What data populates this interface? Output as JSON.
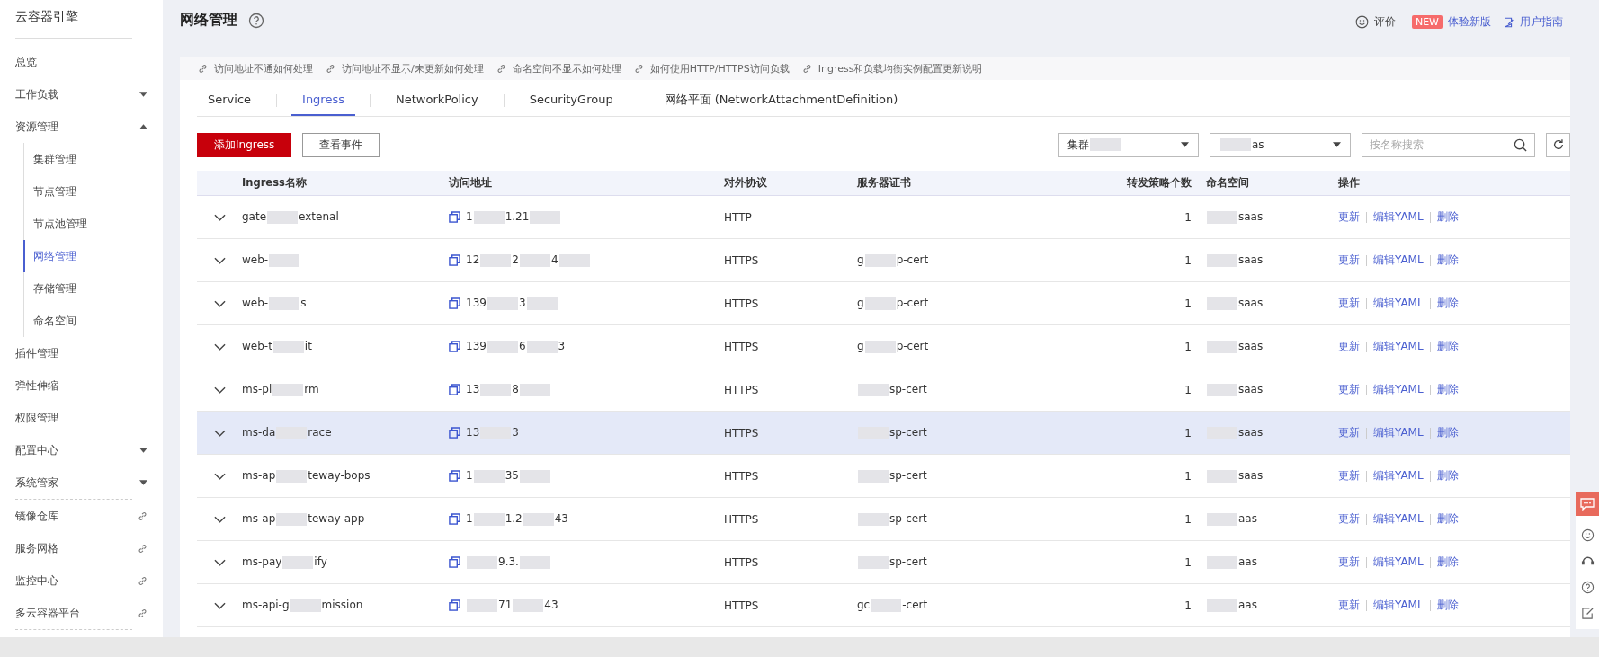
{
  "sidebar": {
    "title": "云容器引擎",
    "items": [
      {
        "label": "总览",
        "kind": "item",
        "selected": false
      },
      {
        "label": "工作负载",
        "kind": "group",
        "expanded": false,
        "selected": false
      },
      {
        "label": "资源管理",
        "kind": "group",
        "expanded": true,
        "selected": false,
        "children": [
          {
            "label": "集群管理",
            "selected": false
          },
          {
            "label": "节点管理",
            "selected": false
          },
          {
            "label": "节点池管理",
            "selected": false
          },
          {
            "label": "网络管理",
            "selected": true
          },
          {
            "label": "存储管理",
            "selected": false
          },
          {
            "label": "命名空间",
            "selected": false
          }
        ]
      },
      {
        "label": "插件管理",
        "kind": "item",
        "selected": false
      },
      {
        "label": "弹性伸缩",
        "kind": "item",
        "selected": false
      },
      {
        "label": "权限管理",
        "kind": "item",
        "selected": false
      },
      {
        "label": "配置中心",
        "kind": "group",
        "expanded": false,
        "selected": false
      },
      {
        "label": "系统管家",
        "kind": "group",
        "expanded": false,
        "selected": false
      },
      {
        "kind": "divider"
      },
      {
        "label": "镜像仓库",
        "kind": "link",
        "selected": false
      },
      {
        "label": "服务网格",
        "kind": "link",
        "selected": false
      },
      {
        "label": "监控中心",
        "kind": "link",
        "selected": false
      },
      {
        "label": "多云容器平台",
        "kind": "link",
        "selected": false
      },
      {
        "kind": "divider"
      }
    ]
  },
  "header": {
    "title": "网络管理",
    "rate": "评价",
    "new_badge": "NEW",
    "new_version": "体验新版",
    "guide": "用户指南"
  },
  "help_links": [
    "访问地址不通如何处理",
    "访问地址不显示/未更新如何处理",
    "命名空间不显示如何处理",
    "如何使用HTTP/HTTPS访问负载",
    "Ingress和负载均衡实例配置更新说明"
  ],
  "tabs": [
    {
      "label": "Service",
      "selected": false
    },
    {
      "label": "Ingress",
      "selected": true
    },
    {
      "label": "NetworkPolicy",
      "selected": false
    },
    {
      "label": "SecurityGroup",
      "selected": false
    },
    {
      "label": "网络平面 (NetworkAttachmentDefinition)",
      "selected": false
    }
  ],
  "toolbar": {
    "add_button": "添加Ingress",
    "events_button": "查看事件",
    "cluster_select": [
      "集群",
      {
        "kind": "blur"
      }
    ],
    "namespace_select": [
      {
        "kind": "blur"
      },
      "as"
    ],
    "search": {
      "placeholder": "按名称搜索"
    }
  },
  "table": {
    "columns": [
      "Ingress名称",
      "访问地址",
      "对外协议",
      "服务器证书",
      "转发策略个数",
      "命名空间",
      "操作"
    ],
    "rows": [
      {
        "highlighted": false,
        "name": [
          "gate",
          {
            "kind": "blur"
          },
          "extenal"
        ],
        "address": [
          "1",
          {
            "kind": "blur"
          },
          "1.21",
          {
            "kind": "blur"
          }
        ],
        "protocol": "HTTP",
        "cert": [
          "--"
        ],
        "rules": "1",
        "namespace": [
          {
            "kind": "blur"
          },
          "saas"
        ],
        "actions": [
          "更新",
          "编辑YAML",
          "删除"
        ]
      },
      {
        "highlighted": false,
        "name": [
          "web-",
          {
            "kind": "blur"
          }
        ],
        "address": [
          "12",
          {
            "kind": "blur"
          },
          "2",
          {
            "kind": "blur"
          },
          "4",
          {
            "kind": "blur"
          }
        ],
        "protocol": "HTTPS",
        "cert": [
          "g",
          {
            "kind": "blur"
          },
          "p-cert"
        ],
        "rules": "1",
        "namespace": [
          {
            "kind": "blur"
          },
          "saas"
        ],
        "actions": [
          "更新",
          "编辑YAML",
          "删除"
        ]
      },
      {
        "highlighted": false,
        "name": [
          "web-",
          {
            "kind": "blur"
          },
          "s"
        ],
        "address": [
          "139",
          {
            "kind": "blur"
          },
          "3",
          {
            "kind": "blur"
          }
        ],
        "protocol": "HTTPS",
        "cert": [
          "g",
          {
            "kind": "blur"
          },
          "p-cert"
        ],
        "rules": "1",
        "namespace": [
          {
            "kind": "blur"
          },
          "saas"
        ],
        "actions": [
          "更新",
          "编辑YAML",
          "删除"
        ]
      },
      {
        "highlighted": false,
        "name": [
          "web-t",
          {
            "kind": "blur"
          },
          "it"
        ],
        "address": [
          "139",
          {
            "kind": "blur"
          },
          "6",
          {
            "kind": "blur"
          },
          "3"
        ],
        "protocol": "HTTPS",
        "cert": [
          "g",
          {
            "kind": "blur"
          },
          "p-cert"
        ],
        "rules": "1",
        "namespace": [
          {
            "kind": "blur"
          },
          "saas"
        ],
        "actions": [
          "更新",
          "编辑YAML",
          "删除"
        ]
      },
      {
        "highlighted": false,
        "name": [
          "ms-pl",
          {
            "kind": "blur"
          },
          "rm"
        ],
        "address": [
          "13",
          {
            "kind": "blur"
          },
          "8",
          {
            "kind": "blur"
          }
        ],
        "protocol": "HTTPS",
        "cert": [
          {
            "kind": "blur"
          },
          "sp-cert"
        ],
        "rules": "1",
        "namespace": [
          {
            "kind": "blur"
          },
          "saas"
        ],
        "actions": [
          "更新",
          "编辑YAML",
          "删除"
        ]
      },
      {
        "highlighted": true,
        "name": [
          "ms-da",
          {
            "kind": "blur"
          },
          "race"
        ],
        "address": [
          "13",
          {
            "kind": "blur"
          },
          "3"
        ],
        "protocol": "HTTPS",
        "cert": [
          {
            "kind": "blur"
          },
          "sp-cert"
        ],
        "rules": "1",
        "namespace": [
          {
            "kind": "blur"
          },
          "saas"
        ],
        "actions": [
          "更新",
          "编辑YAML",
          "删除"
        ]
      },
      {
        "highlighted": false,
        "name": [
          "ms-ap",
          {
            "kind": "blur"
          },
          "teway-bops"
        ],
        "address": [
          "1",
          {
            "kind": "blur"
          },
          "35",
          {
            "kind": "blur"
          }
        ],
        "protocol": "HTTPS",
        "cert": [
          {
            "kind": "blur"
          },
          "sp-cert"
        ],
        "rules": "1",
        "namespace": [
          {
            "kind": "blur"
          },
          "saas"
        ],
        "actions": [
          "更新",
          "编辑YAML",
          "删除"
        ]
      },
      {
        "highlighted": false,
        "name": [
          "ms-ap",
          {
            "kind": "blur"
          },
          "teway-app"
        ],
        "address": [
          "1",
          {
            "kind": "blur"
          },
          "1.2",
          {
            "kind": "blur"
          },
          "43"
        ],
        "protocol": "HTTPS",
        "cert": [
          {
            "kind": "blur"
          },
          "sp-cert"
        ],
        "rules": "1",
        "namespace": [
          {
            "kind": "blur"
          },
          "aas"
        ],
        "actions": [
          "更新",
          "编辑YAML",
          "删除"
        ]
      },
      {
        "highlighted": false,
        "name": [
          "ms-pay",
          {
            "kind": "blur"
          },
          "ify"
        ],
        "address": [
          {
            "kind": "blur"
          },
          "9.3.",
          {
            "kind": "blur"
          }
        ],
        "protocol": "HTTPS",
        "cert": [
          {
            "kind": "blur"
          },
          "sp-cert"
        ],
        "rules": "1",
        "namespace": [
          {
            "kind": "blur"
          },
          "aas"
        ],
        "actions": [
          "更新",
          "编辑YAML",
          "删除"
        ]
      },
      {
        "highlighted": false,
        "name": [
          "ms-api-g",
          {
            "kind": "blur"
          },
          "mission"
        ],
        "address": [
          {
            "kind": "blur"
          },
          "71",
          {
            "kind": "blur"
          },
          "43"
        ],
        "protocol": "HTTPS",
        "cert": [
          "gc",
          {
            "kind": "blur"
          },
          "-cert"
        ],
        "rules": "1",
        "namespace": [
          {
            "kind": "blur"
          },
          "aas"
        ],
        "actions": [
          "更新",
          "编辑YAML",
          "删除"
        ]
      }
    ]
  }
}
